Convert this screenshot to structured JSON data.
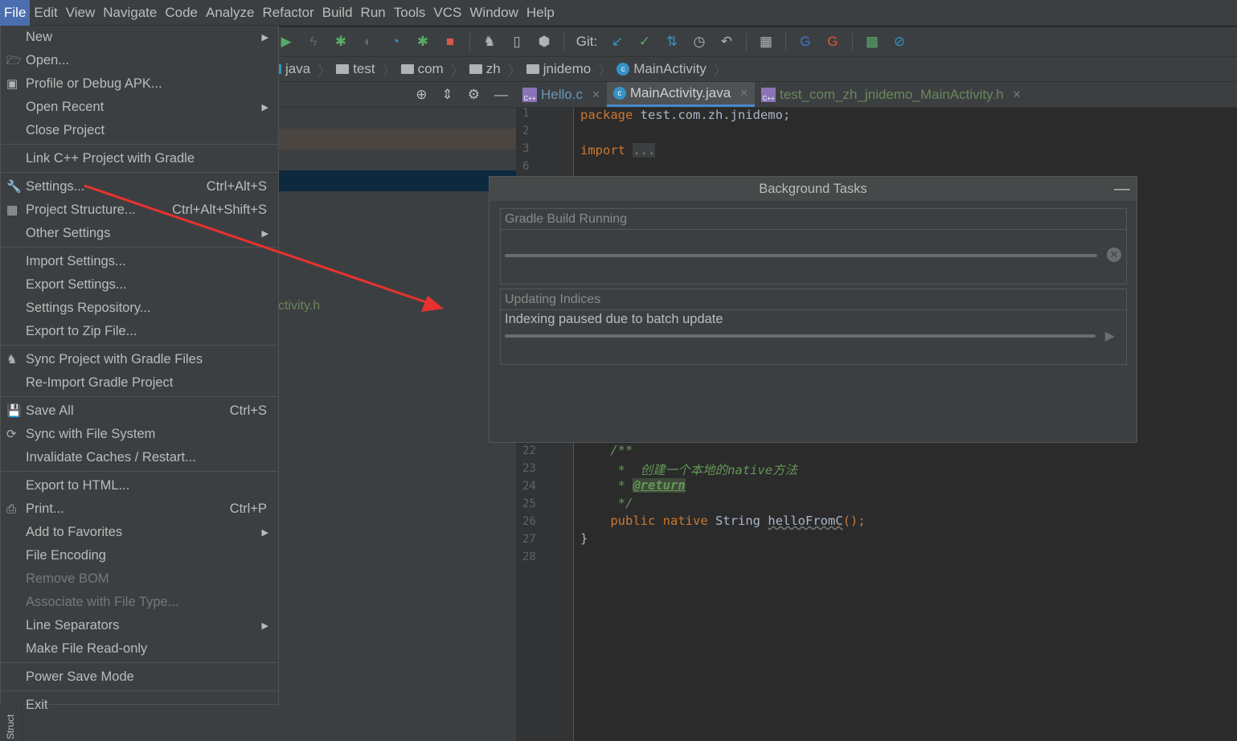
{
  "menubar": [
    "File",
    "Edit",
    "View",
    "Navigate",
    "Code",
    "Analyze",
    "Refactor",
    "Build",
    "Run",
    "Tools",
    "VCS",
    "Window",
    "Help"
  ],
  "toolbar": {
    "git_label": "Git:",
    "icons": [
      "run-icon",
      "apply-changes-icon",
      "debug-icon",
      "attach-debugger-icon",
      "profile-icon",
      "debug-attach-icon",
      "stop-icon",
      "gradle-sync-icon",
      "avd-manager-icon",
      "sdk-manager-icon",
      "git-update-icon",
      "git-commit-icon",
      "git-compare-icon",
      "history-icon",
      "revert-icon",
      "project-structure-icon",
      "translate-icon",
      "translate-alt-icon",
      "monitor-icon",
      "disable-icon"
    ]
  },
  "breadcrumbs": [
    "java",
    "test",
    "com",
    "zh",
    "jnidemo",
    "MainActivity"
  ],
  "tabs": [
    {
      "label": "Hello.c",
      "type": "cpp"
    },
    {
      "label": "MainActivity.java",
      "type": "class",
      "selected": true
    },
    {
      "label": "test_com_zh_jnidemo_MainActivity.h",
      "type": "cpp"
    }
  ],
  "left_panel": {
    "partial_file": "ctivity.h",
    "struct_tab": "Struct"
  },
  "menu": [
    {
      "label": "New",
      "sub": true
    },
    {
      "label": "Open...",
      "icon": "folder-open-icon"
    },
    {
      "label": "Profile or Debug APK...",
      "icon": "apk-icon"
    },
    {
      "label": "Open Recent",
      "sub": true
    },
    {
      "label": "Close Project"
    },
    {
      "label": "Link C++ Project with Gradle",
      "sep": true
    },
    {
      "label": "Settings...",
      "shortcut": "Ctrl+Alt+S",
      "icon": "wrench-icon",
      "sep": true
    },
    {
      "label": "Project Structure...",
      "shortcut": "Ctrl+Alt+Shift+S",
      "icon": "project-structure-icon"
    },
    {
      "label": "Other Settings",
      "sub": true
    },
    {
      "label": "Import Settings...",
      "sep": true
    },
    {
      "label": "Export Settings..."
    },
    {
      "label": "Settings Repository..."
    },
    {
      "label": "Export to Zip File..."
    },
    {
      "label": "Sync Project with Gradle Files",
      "icon": "gradle-sync-icon",
      "sep": true
    },
    {
      "label": "Re-Import Gradle Project"
    },
    {
      "label": "Save All",
      "shortcut": "Ctrl+S",
      "icon": "save-icon",
      "sep": true
    },
    {
      "label": "Sync with File System",
      "icon": "sync-icon"
    },
    {
      "label": "Invalidate Caches / Restart..."
    },
    {
      "label": "Export to HTML...",
      "sep": true
    },
    {
      "label": "Print...",
      "shortcut": "Ctrl+P",
      "icon": "print-icon"
    },
    {
      "label": "Add to Favorites",
      "sub": true
    },
    {
      "label": "File Encoding"
    },
    {
      "label": "Remove BOM",
      "disabled": true
    },
    {
      "label": "Associate with File Type...",
      "disabled": true
    },
    {
      "label": "Line Separators",
      "sub": true
    },
    {
      "label": "Make File Read-only"
    },
    {
      "label": "Power Save Mode",
      "sep": true
    },
    {
      "label": "Exit",
      "sep": true
    }
  ],
  "editor": {
    "line_numbers_top": [
      "1",
      "2",
      "3",
      "6"
    ],
    "line_numbers_bottom": [
      "22",
      "23",
      "24",
      "25",
      "26",
      "27",
      "28"
    ],
    "package_kw": "package",
    "package_name": " test.com.zh.jnidemo;",
    "import_kw": "import",
    "import_fold": "...",
    "doc_open": "/**",
    "doc_line": " *  创建一个本地的native方法",
    "doc_star": " * ",
    "doc_tag": "@return",
    "doc_close": " */",
    "kw_public": "public",
    "kw_native": "native",
    "type_string": "String",
    "method": "helloFromC",
    "method_tail": "();",
    "close_brace": "}"
  },
  "background_tasks": {
    "title": "Background Tasks",
    "tasks": [
      {
        "title": "Gradle Build Running",
        "detail": "",
        "progress": "indeterminate"
      },
      {
        "title": "Updating Indices",
        "detail": "Indexing paused due to batch update",
        "progress": "paused"
      }
    ]
  },
  "colors": {
    "accent": "#4b6eaf",
    "annotation_arrow": "#e8322f"
  }
}
